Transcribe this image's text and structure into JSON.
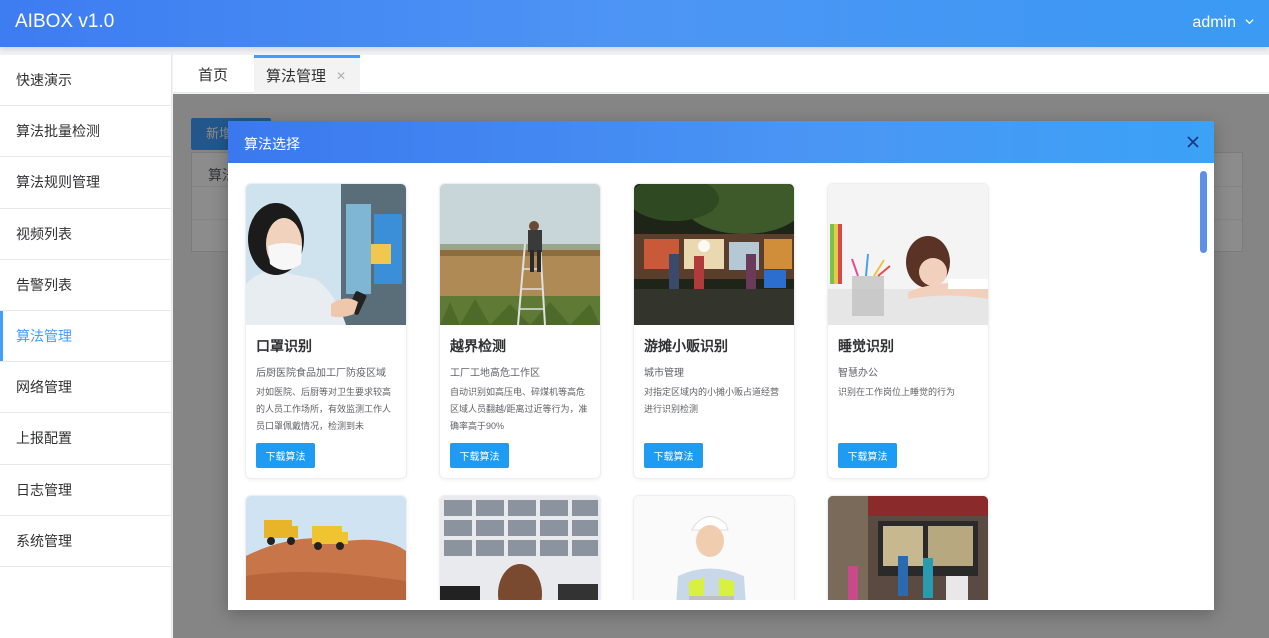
{
  "app": {
    "title": "AIBOX v1.0",
    "user": "admin"
  },
  "sidebar": {
    "items": [
      {
        "label": "快速演示"
      },
      {
        "label": "算法批量检测"
      },
      {
        "label": "算法规则管理"
      },
      {
        "label": "视频列表"
      },
      {
        "label": "告警列表"
      },
      {
        "label": "算法管理",
        "active": true
      },
      {
        "label": "网络管理"
      },
      {
        "label": "上报配置"
      },
      {
        "label": "日志管理"
      },
      {
        "label": "系统管理"
      }
    ]
  },
  "tabs": [
    {
      "label": "首页"
    },
    {
      "label": "算法管理",
      "active": true,
      "close_icon": "close-icon"
    }
  ],
  "background": {
    "new_button": "新增",
    "table_header": "算法"
  },
  "dialog": {
    "title": "算法选择",
    "cards": [
      {
        "title": "口罩识别",
        "subtitle": "后厨医院食品加工厂防疫区域",
        "description": "对如医院、后厨等对卫生要求较高的人员工作场所，有效监测工作人员口罩佩戴情况，检测到未",
        "button": "下载算法",
        "image": "woman-wearing-mask"
      },
      {
        "title": "越界检测",
        "subtitle": "工厂工地高危工作区",
        "description": "自动识别如高压电、碎煤机等高危区域人员翻越/距离过近等行为，准确率高于90%",
        "button": "下载算法",
        "image": "man-climbing-wall"
      },
      {
        "title": "游摊小贩识别",
        "subtitle": "城市管理",
        "description": "对指定区域内的小摊小贩占道经营进行识别检测",
        "button": "下载算法",
        "image": "night-street-vendors"
      },
      {
        "title": "睡觉识别",
        "subtitle": "智慧办公",
        "description": "识别在工作岗位上睡觉的行为",
        "button": "下载算法",
        "image": "woman-sleeping-at-desk"
      },
      {
        "image": "dump-trucks-on-dirt"
      },
      {
        "image": "monitoring-room-screens"
      },
      {
        "image": "worker-in-hardhat-vest"
      },
      {
        "image": "street-shop-scene"
      }
    ]
  },
  "colors": {
    "accent": "#409eff",
    "button": "#1e9cf3",
    "header_start": "#3d7cf1",
    "header_end": "#3a9af4"
  }
}
